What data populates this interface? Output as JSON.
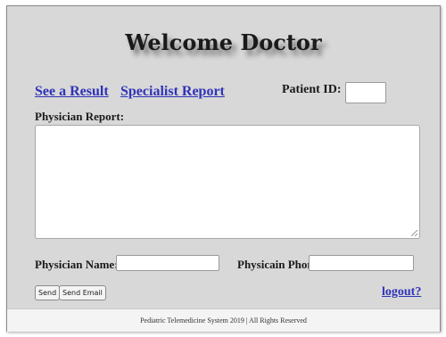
{
  "header": {
    "title": "Welcome Doctor"
  },
  "nav": {
    "see_result": "See a Result",
    "specialist_report": "Specialist Report"
  },
  "patient": {
    "label": "Patient ID:",
    "value": ""
  },
  "report": {
    "label": "Physician Report:",
    "value": ""
  },
  "physician": {
    "name_label": "Physician Name:",
    "name_value": "",
    "phone_label": "Physicain Phone:",
    "phone_value": ""
  },
  "actions": {
    "send": "Send",
    "send_email": "Send Email",
    "logout": "logout?"
  },
  "footer": {
    "text": "Pediatric Telemedicine System 2019 | All Rights Reserved"
  },
  "colors": {
    "panel_bg": "#d8d8d8",
    "link": "#2f33b8",
    "footer_bg": "#f4f4f4"
  }
}
